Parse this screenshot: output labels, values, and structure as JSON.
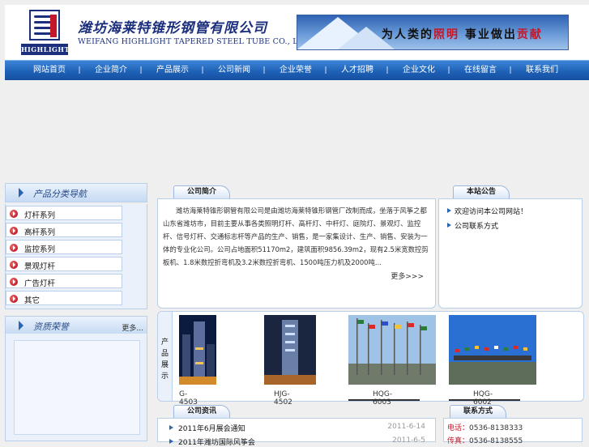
{
  "header": {
    "logo_word": "HIGHLIGHT",
    "company_cn": "潍坊海莱特锥形钢管有限公司",
    "company_en": "WEIFANG HIGHLIGHT TAPERED STEEL TUBE CO., LTD.",
    "slogan_pre": "为人类的",
    "slogan_red1": "照明",
    "slogan_mid": " 事业做出",
    "slogan_red2": "贡献"
  },
  "nav": {
    "items": [
      "网站首页",
      "企业简介",
      "产品展示",
      "公司新闻",
      "企业荣誉",
      "人才招聘",
      "企业文化",
      "在线留言",
      "联系我们"
    ],
    "separator": "|"
  },
  "categories": {
    "title": "产品分类导航",
    "items": [
      "灯杆系列",
      "高杆系列",
      "监控系列",
      "景观灯杆",
      "广告灯杆",
      "其它"
    ]
  },
  "honors": {
    "title": "资质荣誉",
    "more": "更多..."
  },
  "about": {
    "tab": "公司简介",
    "text": "潍坊海莱特锥形钢管有限公司是由潍坊海莱特锥形钢管厂改制而成，坐落于风筝之都山东省潍坊市，目前主要从事各类照明灯杆、高杆灯、中杆灯、庭院灯、景观灯、监控杆、信号灯杆、交通标志杆等产品的生产、销售，是一家集设计、生产、销售、安装为一体的专业化公司。公司占地面积51170m2，建筑面积9856.39m2，现有2.5米宽数控剪板机、1.8米数控折弯机及3.2米数控折弯机、1500吨压力机及2000吨...",
    "more": "更多>>>"
  },
  "notice": {
    "tab": "本站公告",
    "items": [
      "欢迎访问本公司网站！",
      "公司联系方式"
    ]
  },
  "products": {
    "label": [
      "产",
      "品",
      "展",
      "示"
    ],
    "items": [
      {
        "caption": "G-4503"
      },
      {
        "caption": "HJG-4502"
      },
      {
        "caption": "HQG-6003"
      },
      {
        "caption": "HQG-6002"
      }
    ]
  },
  "news": {
    "tab": "公司资讯",
    "items": [
      {
        "title": "2011年6月展会通知",
        "date": "2011-6-14"
      },
      {
        "title": "2011年潍坊国际风筝会",
        "date": "2011-6-5"
      }
    ]
  },
  "contact": {
    "tab": "联系方式",
    "rows": [
      {
        "k": "电话：",
        "v": "0536-8138333"
      },
      {
        "k": "传真：",
        "v": "0536-8138555"
      }
    ]
  },
  "colors": {
    "nav_blue": "#1c5fb4",
    "brand_navy": "#1b2f7c",
    "accent_red": "#c3182a"
  }
}
